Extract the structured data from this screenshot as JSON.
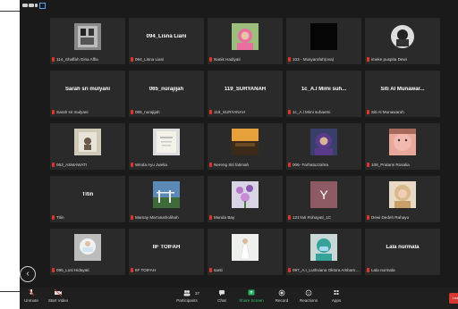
{
  "window": {
    "accent": "#1a1a1a"
  },
  "grid": {
    "tiles": [
      {
        "label": "114_Shaffah Gina Affia",
        "kind": "image",
        "art": "frame"
      },
      {
        "label": "094_Lisna Liani",
        "kind": "name",
        "bigname": "094_Lisna Liani"
      },
      {
        "label": "Nanik Hadiyati",
        "kind": "image",
        "art": "hijab-pink"
      },
      {
        "label": "103 - Musyarofah(ova)",
        "kind": "image",
        "art": "black"
      },
      {
        "label": "imeke puspita Dewi",
        "kind": "image",
        "art": "portrait-dark"
      },
      {
        "label": "Sarah sri mulyani",
        "kind": "name",
        "bigname": "Sarah sri mulyani"
      },
      {
        "label": "065_nurajijah",
        "kind": "name",
        "bigname": "065_nurajijah"
      },
      {
        "label": "119_SURYANAH",
        "kind": "name",
        "bigname": "119_SURYANAH"
      },
      {
        "label": "1c_A.l Mimi suhaemi",
        "kind": "name",
        "bigname": "1c_A.l Mimi suh..."
      },
      {
        "label": "Siti Al Munawaroh",
        "kind": "name",
        "bigname": "Siti Al Munawar..."
      },
      {
        "label": "063_ASMAWATI",
        "kind": "image",
        "art": "light-sketch"
      },
      {
        "label": "Winda Ayu Jwelia",
        "kind": "image",
        "art": "card"
      },
      {
        "label": "Nereng Siti fatimah",
        "kind": "image",
        "art": "sunset"
      },
      {
        "label": "006- Farhatuzzahra",
        "kind": "image",
        "art": "hijab-purple"
      },
      {
        "label": "108_Pratami Rosalia",
        "kind": "image",
        "art": "pink-face"
      },
      {
        "label": "Titin",
        "kind": "name",
        "bigname": "Titin"
      },
      {
        "label": "Mamay Mar'atusholihah",
        "kind": "image",
        "art": "bridge"
      },
      {
        "label": "Munda Bay",
        "kind": "image",
        "art": "flowers"
      },
      {
        "label": "121Yati Rohayati_1C",
        "kind": "image",
        "art": "letter-y",
        "letter": "Y"
      },
      {
        "label": "Dewi Dedeh Rahayu",
        "kind": "image",
        "art": "woman-blond"
      },
      {
        "label": "096_Lusi Hidayati",
        "kind": "image",
        "art": "mask"
      },
      {
        "label": "IIF TOIFAH",
        "kind": "name",
        "bigname": "IIF TOIFAH"
      },
      {
        "label": "santi",
        "kind": "image",
        "art": "white-dress"
      },
      {
        "label": "097_A.I_Luthviana Oktora Ambarsari",
        "kind": "image",
        "art": "medic"
      },
      {
        "label": "Lala nurmala",
        "kind": "name",
        "bigname": "Lala nurmala"
      }
    ]
  },
  "toolbar": {
    "unmute": "Unmute",
    "start_video": "Start Video",
    "participants": "Participants",
    "participants_count": "37",
    "chat": "Chat",
    "share_screen": "Share Screen",
    "record": "Record",
    "reactions": "Reactions",
    "apps": "Apps",
    "leave": "Lea"
  },
  "nav": {
    "prev": "‹"
  }
}
